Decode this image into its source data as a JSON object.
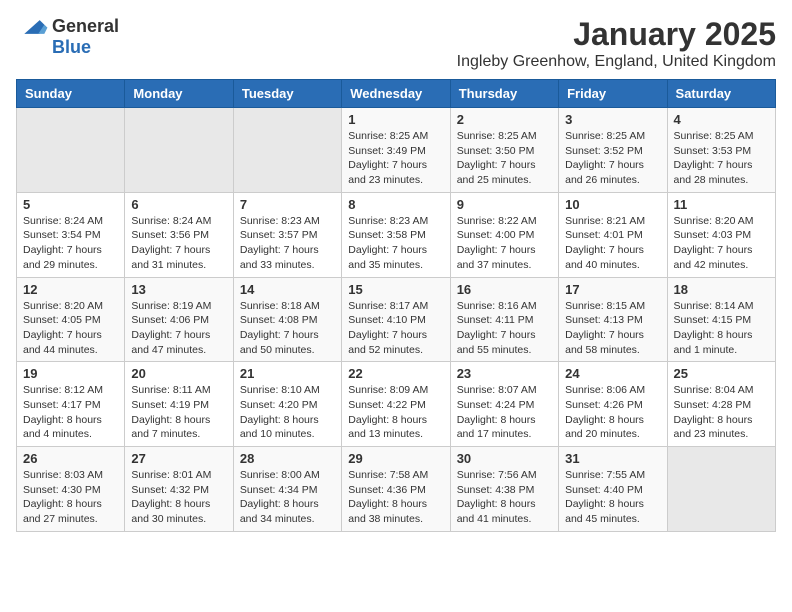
{
  "header": {
    "logo_general": "General",
    "logo_blue": "Blue",
    "month_title": "January 2025",
    "location": "Ingleby Greenhow, England, United Kingdom"
  },
  "calendar": {
    "weekdays": [
      "Sunday",
      "Monday",
      "Tuesday",
      "Wednesday",
      "Thursday",
      "Friday",
      "Saturday"
    ],
    "rows": [
      [
        {
          "day": "",
          "sunrise": "",
          "sunset": "",
          "daylight": ""
        },
        {
          "day": "",
          "sunrise": "",
          "sunset": "",
          "daylight": ""
        },
        {
          "day": "",
          "sunrise": "",
          "sunset": "",
          "daylight": ""
        },
        {
          "day": "1",
          "sunrise": "Sunrise: 8:25 AM",
          "sunset": "Sunset: 3:49 PM",
          "daylight": "Daylight: 7 hours and 23 minutes."
        },
        {
          "day": "2",
          "sunrise": "Sunrise: 8:25 AM",
          "sunset": "Sunset: 3:50 PM",
          "daylight": "Daylight: 7 hours and 25 minutes."
        },
        {
          "day": "3",
          "sunrise": "Sunrise: 8:25 AM",
          "sunset": "Sunset: 3:52 PM",
          "daylight": "Daylight: 7 hours and 26 minutes."
        },
        {
          "day": "4",
          "sunrise": "Sunrise: 8:25 AM",
          "sunset": "Sunset: 3:53 PM",
          "daylight": "Daylight: 7 hours and 28 minutes."
        }
      ],
      [
        {
          "day": "5",
          "sunrise": "Sunrise: 8:24 AM",
          "sunset": "Sunset: 3:54 PM",
          "daylight": "Daylight: 7 hours and 29 minutes."
        },
        {
          "day": "6",
          "sunrise": "Sunrise: 8:24 AM",
          "sunset": "Sunset: 3:56 PM",
          "daylight": "Daylight: 7 hours and 31 minutes."
        },
        {
          "day": "7",
          "sunrise": "Sunrise: 8:23 AM",
          "sunset": "Sunset: 3:57 PM",
          "daylight": "Daylight: 7 hours and 33 minutes."
        },
        {
          "day": "8",
          "sunrise": "Sunrise: 8:23 AM",
          "sunset": "Sunset: 3:58 PM",
          "daylight": "Daylight: 7 hours and 35 minutes."
        },
        {
          "day": "9",
          "sunrise": "Sunrise: 8:22 AM",
          "sunset": "Sunset: 4:00 PM",
          "daylight": "Daylight: 7 hours and 37 minutes."
        },
        {
          "day": "10",
          "sunrise": "Sunrise: 8:21 AM",
          "sunset": "Sunset: 4:01 PM",
          "daylight": "Daylight: 7 hours and 40 minutes."
        },
        {
          "day": "11",
          "sunrise": "Sunrise: 8:20 AM",
          "sunset": "Sunset: 4:03 PM",
          "daylight": "Daylight: 7 hours and 42 minutes."
        }
      ],
      [
        {
          "day": "12",
          "sunrise": "Sunrise: 8:20 AM",
          "sunset": "Sunset: 4:05 PM",
          "daylight": "Daylight: 7 hours and 44 minutes."
        },
        {
          "day": "13",
          "sunrise": "Sunrise: 8:19 AM",
          "sunset": "Sunset: 4:06 PM",
          "daylight": "Daylight: 7 hours and 47 minutes."
        },
        {
          "day": "14",
          "sunrise": "Sunrise: 8:18 AM",
          "sunset": "Sunset: 4:08 PM",
          "daylight": "Daylight: 7 hours and 50 minutes."
        },
        {
          "day": "15",
          "sunrise": "Sunrise: 8:17 AM",
          "sunset": "Sunset: 4:10 PM",
          "daylight": "Daylight: 7 hours and 52 minutes."
        },
        {
          "day": "16",
          "sunrise": "Sunrise: 8:16 AM",
          "sunset": "Sunset: 4:11 PM",
          "daylight": "Daylight: 7 hours and 55 minutes."
        },
        {
          "day": "17",
          "sunrise": "Sunrise: 8:15 AM",
          "sunset": "Sunset: 4:13 PM",
          "daylight": "Daylight: 7 hours and 58 minutes."
        },
        {
          "day": "18",
          "sunrise": "Sunrise: 8:14 AM",
          "sunset": "Sunset: 4:15 PM",
          "daylight": "Daylight: 8 hours and 1 minute."
        }
      ],
      [
        {
          "day": "19",
          "sunrise": "Sunrise: 8:12 AM",
          "sunset": "Sunset: 4:17 PM",
          "daylight": "Daylight: 8 hours and 4 minutes."
        },
        {
          "day": "20",
          "sunrise": "Sunrise: 8:11 AM",
          "sunset": "Sunset: 4:19 PM",
          "daylight": "Daylight: 8 hours and 7 minutes."
        },
        {
          "day": "21",
          "sunrise": "Sunrise: 8:10 AM",
          "sunset": "Sunset: 4:20 PM",
          "daylight": "Daylight: 8 hours and 10 minutes."
        },
        {
          "day": "22",
          "sunrise": "Sunrise: 8:09 AM",
          "sunset": "Sunset: 4:22 PM",
          "daylight": "Daylight: 8 hours and 13 minutes."
        },
        {
          "day": "23",
          "sunrise": "Sunrise: 8:07 AM",
          "sunset": "Sunset: 4:24 PM",
          "daylight": "Daylight: 8 hours and 17 minutes."
        },
        {
          "day": "24",
          "sunrise": "Sunrise: 8:06 AM",
          "sunset": "Sunset: 4:26 PM",
          "daylight": "Daylight: 8 hours and 20 minutes."
        },
        {
          "day": "25",
          "sunrise": "Sunrise: 8:04 AM",
          "sunset": "Sunset: 4:28 PM",
          "daylight": "Daylight: 8 hours and 23 minutes."
        }
      ],
      [
        {
          "day": "26",
          "sunrise": "Sunrise: 8:03 AM",
          "sunset": "Sunset: 4:30 PM",
          "daylight": "Daylight: 8 hours and 27 minutes."
        },
        {
          "day": "27",
          "sunrise": "Sunrise: 8:01 AM",
          "sunset": "Sunset: 4:32 PM",
          "daylight": "Daylight: 8 hours and 30 minutes."
        },
        {
          "day": "28",
          "sunrise": "Sunrise: 8:00 AM",
          "sunset": "Sunset: 4:34 PM",
          "daylight": "Daylight: 8 hours and 34 minutes."
        },
        {
          "day": "29",
          "sunrise": "Sunrise: 7:58 AM",
          "sunset": "Sunset: 4:36 PM",
          "daylight": "Daylight: 8 hours and 38 minutes."
        },
        {
          "day": "30",
          "sunrise": "Sunrise: 7:56 AM",
          "sunset": "Sunset: 4:38 PM",
          "daylight": "Daylight: 8 hours and 41 minutes."
        },
        {
          "day": "31",
          "sunrise": "Sunrise: 7:55 AM",
          "sunset": "Sunset: 4:40 PM",
          "daylight": "Daylight: 8 hours and 45 minutes."
        },
        {
          "day": "",
          "sunrise": "",
          "sunset": "",
          "daylight": ""
        }
      ]
    ]
  }
}
